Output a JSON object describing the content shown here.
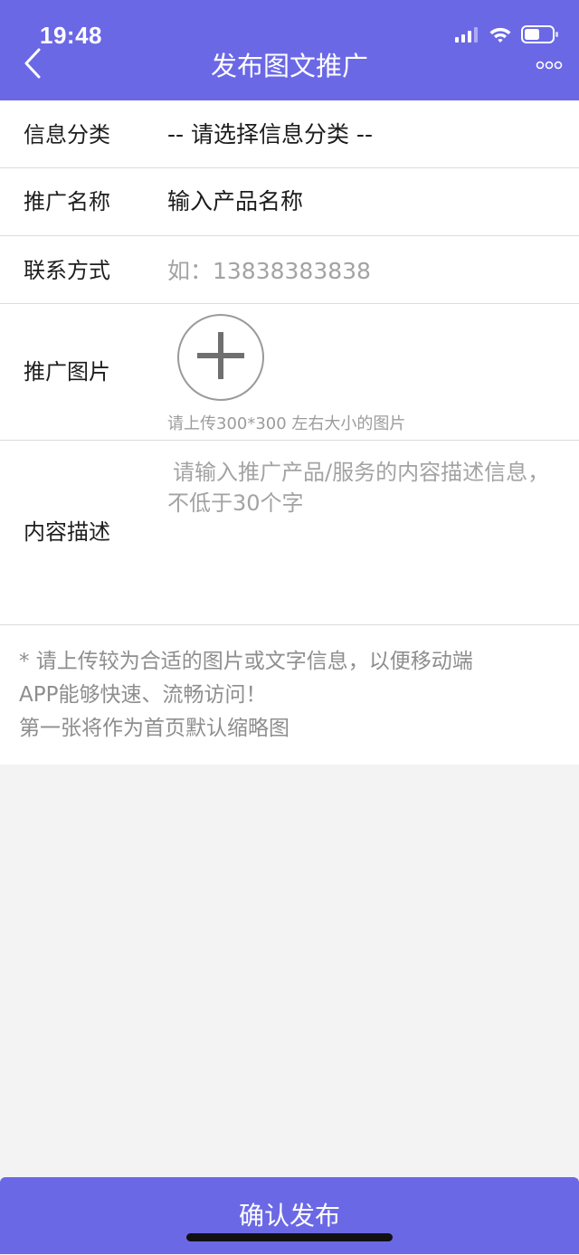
{
  "status_bar": {
    "time": "19:48",
    "icons": [
      "signal-icon",
      "wifi-icon",
      "battery-icon"
    ]
  },
  "nav": {
    "title": "发布图文推广",
    "back_icon": "chevron-left-icon",
    "more_icon": "more-dots-icon"
  },
  "form": {
    "category": {
      "label": "信息分类",
      "value": "-- 请选择信息分类 --"
    },
    "name": {
      "label": "推广名称",
      "placeholder": "输入产品名称"
    },
    "contact": {
      "label": "联系方式",
      "placeholder": "如：13838383838"
    },
    "image": {
      "label": "推广图片",
      "hint": "请上传300*300 左右大小的图片",
      "icon": "plus-icon"
    },
    "description": {
      "label": "内容描述",
      "placeholder": "请输入推广产品/服务的内容描述信息，不低于30个字"
    }
  },
  "notice": {
    "lines": [
      "* 请上传较为合适的图片或文字信息，以便移动端",
      "APP能够快速、流畅访问！",
      "第一张将作为首页默认缩略图"
    ]
  },
  "submit": {
    "label": "确认发布"
  },
  "colors": {
    "accent": "#6b68e6",
    "background": "#f3f3f3",
    "placeholder": "#a3a3a3"
  }
}
